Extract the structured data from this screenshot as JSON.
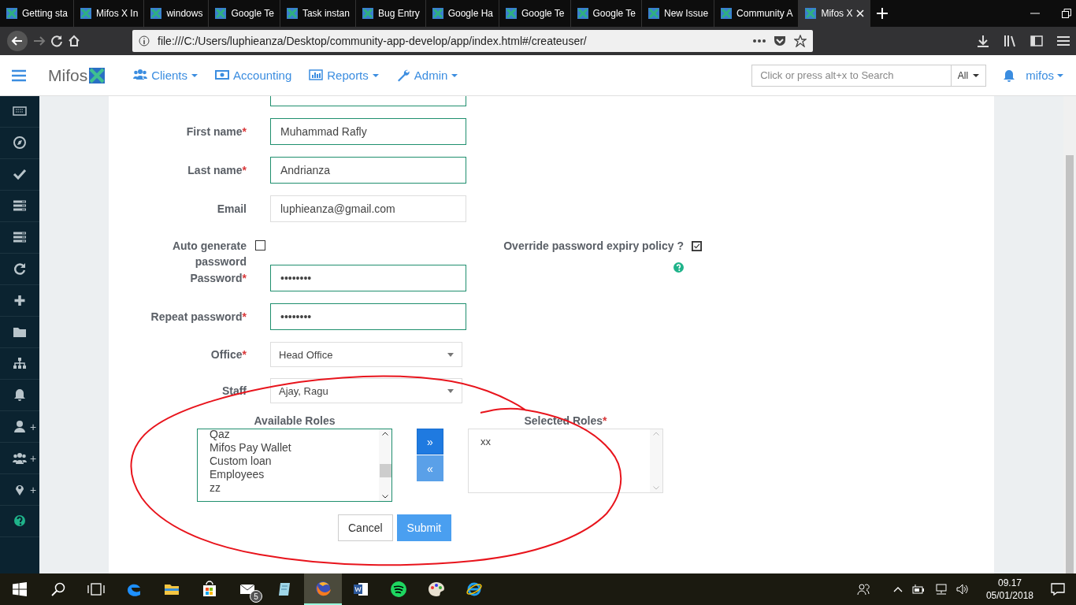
{
  "browser": {
    "tabs": [
      {
        "label": "Getting sta",
        "selected": false
      },
      {
        "label": "Mifos X In",
        "selected": false
      },
      {
        "label": "windows",
        "selected": false
      },
      {
        "label": "Google Te",
        "selected": false
      },
      {
        "label": "Task instan",
        "selected": false
      },
      {
        "label": "Bug Entry",
        "selected": false
      },
      {
        "label": "Google Ha",
        "selected": false
      },
      {
        "label": "Google Te",
        "selected": false
      },
      {
        "label": "Google Te",
        "selected": false
      },
      {
        "label": "New Issue",
        "selected": false
      },
      {
        "label": "Community A",
        "selected": false
      },
      {
        "label": "Mifos X",
        "selected": true
      }
    ],
    "url": "file:///C:/Users/luphieanza/Desktop/community-app-develop/app/index.html#/createuser/"
  },
  "app": {
    "logo": "Mifos",
    "menu": [
      {
        "label": "Clients",
        "kind": "users",
        "dropdown": true
      },
      {
        "label": "Accounting",
        "kind": "money",
        "dropdown": false
      },
      {
        "label": "Reports",
        "kind": "chart",
        "dropdown": true
      },
      {
        "label": "Admin",
        "kind": "wrench",
        "dropdown": true
      }
    ],
    "search": {
      "placeholder": "Click or press alt+x to Search",
      "scope": "All"
    },
    "user": "mifos"
  },
  "sidebar": {
    "items": [
      {
        "kind": "keyboard"
      },
      {
        "kind": "compass"
      },
      {
        "kind": "check"
      },
      {
        "kind": "list"
      },
      {
        "kind": "list"
      },
      {
        "kind": "refresh"
      },
      {
        "kind": "plus"
      },
      {
        "kind": "folder"
      },
      {
        "kind": "sitemap"
      },
      {
        "kind": "bell"
      },
      {
        "kind": "user",
        "suffix": "+"
      },
      {
        "kind": "users",
        "suffix": "+"
      },
      {
        "kind": "marker",
        "suffix": "+"
      },
      {
        "kind": "help"
      }
    ]
  },
  "form": {
    "fields": [
      {
        "label": "First name",
        "marker": "*",
        "value": "Muhammad Rafly",
        "validated": true
      },
      {
        "label": "Last name",
        "marker": "*",
        "value": "Andrianza",
        "validated": true
      },
      {
        "label": "Email",
        "value": "luphieanza@gmail.com",
        "validated": false
      }
    ],
    "auto_generate": {
      "label": "Auto generate password",
      "checked": false
    },
    "override_expiry": {
      "label": "Override password expiry policy ?",
      "checked": true
    },
    "passwords": [
      {
        "label": "Password",
        "marker": "*",
        "value": "••••••••",
        "validated": true
      },
      {
        "label": "Repeat password",
        "marker": "*",
        "value": "••••••••",
        "validated": true
      }
    ],
    "selects": [
      {
        "label": "Office",
        "marker": "*",
        "value": "Head Office"
      },
      {
        "label": "Staff",
        "value": "Ajay, Ragu"
      }
    ],
    "available_roles": {
      "label": "Available Roles",
      "items": [
        "Qaz",
        "Mifos Pay Wallet",
        "Custom loan",
        "Employees",
        "zz"
      ]
    },
    "move_buttons": [
      "»",
      "«"
    ],
    "selected_roles": {
      "label": "Selected Roles",
      "marker": "*",
      "items": [
        "xx"
      ]
    },
    "buttons": [
      {
        "label": "Cancel",
        "kind": "secondary"
      },
      {
        "label": "Submit",
        "kind": "primary"
      }
    ]
  },
  "taskbar": {
    "apps": [
      {
        "kind": "edge",
        "selected": false
      },
      {
        "kind": "explorer",
        "selected": false
      },
      {
        "kind": "store",
        "selected": false
      },
      {
        "kind": "mail",
        "badge": "5",
        "selected": false
      },
      {
        "kind": "notes",
        "selected": false
      },
      {
        "kind": "firefox",
        "selected": true
      },
      {
        "kind": "word",
        "selected": false
      },
      {
        "kind": "spotify",
        "selected": false
      },
      {
        "kind": "paint",
        "selected": false
      },
      {
        "kind": "ie",
        "selected": false
      }
    ],
    "time": "09.17",
    "date": "05/01/2018"
  }
}
